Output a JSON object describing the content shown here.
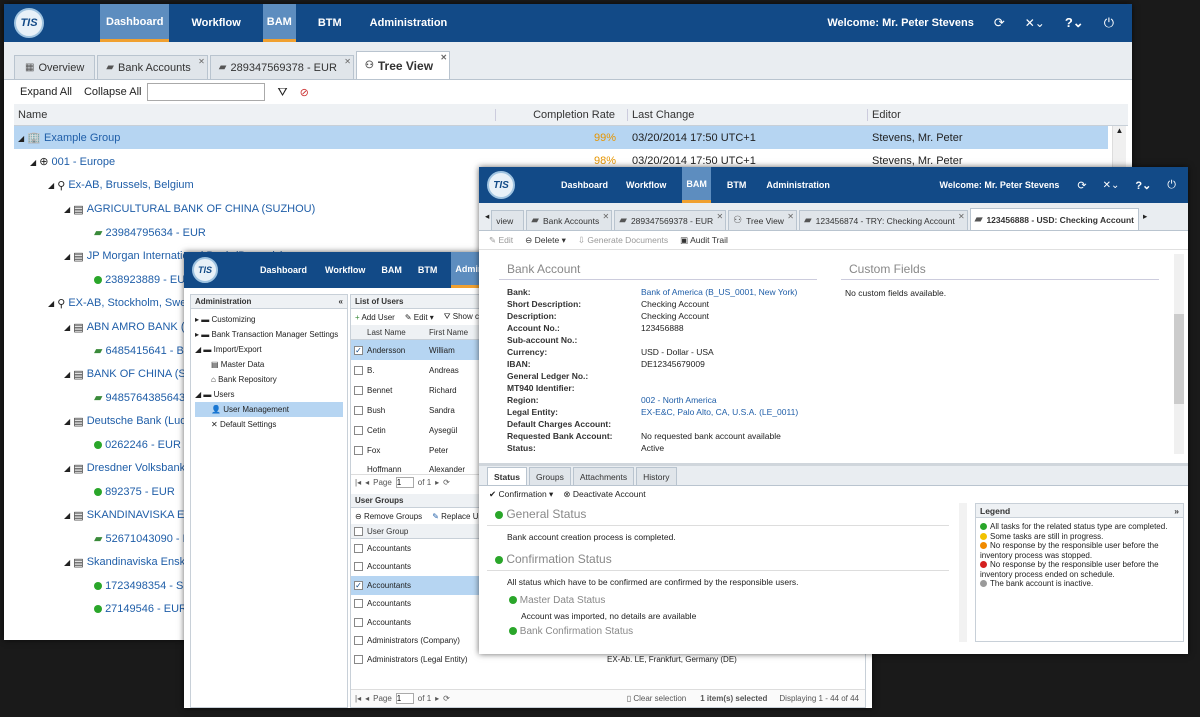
{
  "main": {
    "logo": "TIS",
    "nav": [
      "Dashboard",
      "Workflow",
      "BAM",
      "BTM",
      "Administration"
    ],
    "welcome": "Welcome: Mr. Peter Stevens",
    "tabs": [
      "Overview",
      "Bank Accounts",
      "289347569378 - EUR",
      "Tree View"
    ],
    "toolbar": {
      "expand": "Expand All",
      "collapse": "Collapse All",
      "filter_placeholder": ""
    },
    "columns": [
      "Name",
      "Completion Rate",
      "Last Change",
      "Editor"
    ],
    "rows": [
      {
        "name": "Example Group",
        "rate": "99%",
        "change": "03/20/2014 17:50 UTC+1",
        "editor": "Stevens, Mr. Peter"
      },
      {
        "name": "001 - Europe",
        "rate": "98%",
        "change": "03/20/2014 17:50 UTC+1",
        "editor": "Stevens, Mr. Peter"
      },
      {
        "name": "Ex-AB, Brussels, Belgium"
      },
      {
        "name": "AGRICULTURAL BANK OF CHINA (SUZHOU)"
      },
      {
        "name": "23984795634 - EUR"
      },
      {
        "name": "JP Morgan International Bank (Brussels)"
      },
      {
        "name": "238923889 - EUR:"
      },
      {
        "name": "EX-AB, Stockholm, Swede"
      },
      {
        "name": "ABN AMRO BANK (Pols"
      },
      {
        "name": "6485415641 - BAM"
      },
      {
        "name": "BANK OF CHINA (SUZH"
      },
      {
        "name": "9485764385643 - I"
      },
      {
        "name": "Deutsche Bank (Ludwi"
      },
      {
        "name": "0262246 - EUR"
      },
      {
        "name": "Dresdner Volksbank Ra"
      },
      {
        "name": "892375 - EUR"
      },
      {
        "name": "SKANDINAVISKA ENSK"
      },
      {
        "name": "52671043090 - EUR"
      },
      {
        "name": "Skandinaviska Enskida"
      },
      {
        "name": "1723498354 - SEK:"
      },
      {
        "name": "27149546 - EUR: C"
      }
    ]
  },
  "admin": {
    "logo": "TIS",
    "nav": [
      "Dashboard",
      "Workflow",
      "BAM",
      "BTM",
      "Admini"
    ],
    "panel_title": "Administration",
    "tree": [
      "Customizing",
      "Bank Transaction Manager Settings",
      "Import/Export",
      "Master Data",
      "Bank Repository",
      "Users",
      "User Management",
      "Default Settings"
    ],
    "users_title": "List of Users",
    "users_toolbar": [
      "Add User",
      "Edit",
      "Show c"
    ],
    "users_cols": [
      "Last Name",
      "First Name"
    ],
    "users": [
      {
        "last": "Andersson",
        "first": "William"
      },
      {
        "last": "B.",
        "first": "Andreas"
      },
      {
        "last": "Bennet",
        "first": "Richard"
      },
      {
        "last": "Bush",
        "first": "Sandra"
      },
      {
        "last": "Cetin",
        "first": "Aysegül"
      },
      {
        "last": "Fox",
        "first": "Peter"
      },
      {
        "last": "Hoffmann",
        "first": "Alexander"
      }
    ],
    "pager": {
      "page_lbl": "Page",
      "page": "1",
      "of": "of 1"
    },
    "groups_title": "User Groups",
    "groups_toolbar": [
      "Remove Groups",
      "Replace User"
    ],
    "groups_col": "User Group",
    "groups": [
      "Accountants",
      "Accountants",
      "Accountants",
      "Accountants",
      "Accountants",
      "Administrators (Company)",
      "Administrators (Legal Entity)"
    ],
    "groups_extra": "EX-Ab. LE, Frankfurt, Germany (DE)",
    "footer": {
      "clear": "Clear selection",
      "selected": "1 item(s) selected",
      "displaying": "Displaying 1 - 44 of 44"
    }
  },
  "detail": {
    "logo": "TIS",
    "nav": [
      "Dashboard",
      "Workflow",
      "BAM",
      "BTM",
      "Administration"
    ],
    "welcome": "Welcome: Mr. Peter Stevens",
    "tabs": [
      "view",
      "Bank Accounts",
      "289347569378 - EUR",
      "Tree View",
      "123456874 - TRY: Checking Account",
      "123456888 - USD: Checking Account"
    ],
    "actions": [
      "Edit",
      "Delete",
      "Generate Documents",
      "Audit Trail"
    ],
    "section_bank": "Bank Account",
    "section_custom": "Custom Fields",
    "custom_text": "No custom fields available.",
    "fields": [
      {
        "label": "Bank:",
        "value": "Bank of America (B_US_0001, New York)",
        "link": true
      },
      {
        "label": "Short Description:",
        "value": "Checking Account"
      },
      {
        "label": "Description:",
        "value": "Checking Account"
      },
      {
        "label": "Account No.:",
        "value": "123456888"
      },
      {
        "label": "Sub-account No.:",
        "value": ""
      },
      {
        "label": "Currency:",
        "value": "USD - Dollar - USA"
      },
      {
        "label": "IBAN:",
        "value": "DE12345679009"
      },
      {
        "label": "General Ledger No.:",
        "value": ""
      },
      {
        "label": "MT940 Identifier:",
        "value": ""
      },
      {
        "label": "Region:",
        "value": "002 - North America",
        "link": true
      },
      {
        "label": "Legal Entity:",
        "value": "EX-E&C, Palo Alto, CA, U.S.A. (LE_0011)",
        "link": true
      },
      {
        "label": "Default Charges Account:",
        "value": ""
      },
      {
        "label": "Requested Bank Account:",
        "value": "No requested bank account available"
      },
      {
        "label": "Status:",
        "value": "Active"
      }
    ],
    "status_tabs": [
      "Status",
      "Groups",
      "Attachments",
      "History"
    ],
    "status_actions": [
      "Confirmation",
      "Deactivate Account"
    ],
    "general_status": "General Status",
    "general_text": "Bank account creation process is completed.",
    "confirm_status": "Confirmation Status",
    "confirm_text": "All status which have to be confirmed are confirmed by the responsible users.",
    "master_status": "Master Data Status",
    "master_text": "Account was imported, no details are available",
    "bank_confirm": "Bank Confirmation Status",
    "legend_title": "Legend",
    "legend": [
      {
        "color": "#2aa62a",
        "text": "All tasks for the related status type are completed."
      },
      {
        "color": "#f2c200",
        "text": "Some tasks are still in progress."
      },
      {
        "color": "#f08a00",
        "text": "No response by the responsible user before the inventory process was stopped."
      },
      {
        "color": "#d42020",
        "text": "No response by the responsible user before the inventory process ended on schedule."
      },
      {
        "color": "#9a9a9a",
        "text": "The bank account is inactive."
      }
    ]
  }
}
